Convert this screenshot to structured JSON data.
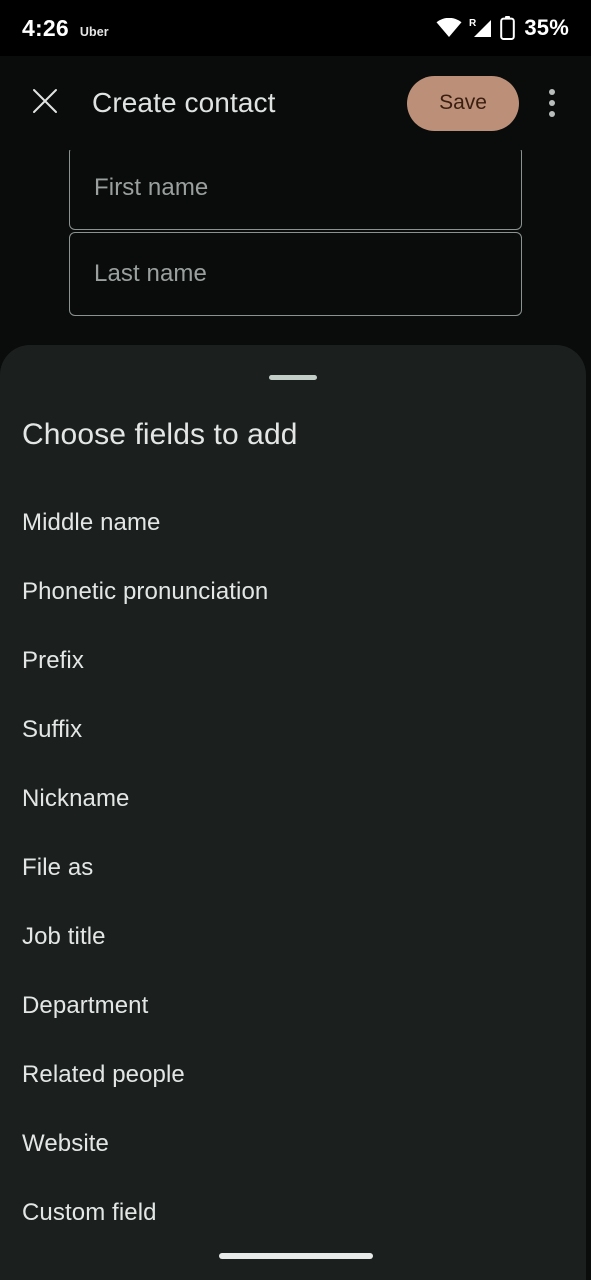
{
  "status_bar": {
    "time": "4:26",
    "notification_app": "Uber",
    "battery_percent": "35%",
    "icons": [
      "wifi-icon",
      "cellular-roaming-icon",
      "battery-icon"
    ]
  },
  "app_bar": {
    "close_icon": "close-icon",
    "title": "Create contact",
    "save_label": "Save",
    "overflow_icon": "more-vertical-icon",
    "save_bg_color": "#bc8f78",
    "save_text_color": "#3a1e10"
  },
  "form": {
    "first_name": {
      "placeholder": "First name",
      "value": ""
    },
    "last_name": {
      "placeholder": "Last name",
      "value": ""
    }
  },
  "bottom_sheet": {
    "handle": "drag-handle",
    "title": "Choose fields to add",
    "options": [
      {
        "label": "Middle name"
      },
      {
        "label": "Phonetic pronunciation"
      },
      {
        "label": "Prefix"
      },
      {
        "label": "Suffix"
      },
      {
        "label": "Nickname"
      },
      {
        "label": "File as"
      },
      {
        "label": "Job title"
      },
      {
        "label": "Department"
      },
      {
        "label": "Related people"
      },
      {
        "label": "Website"
      },
      {
        "label": "Custom field"
      }
    ],
    "background_color": "#1b201e"
  },
  "nav_bar": {
    "handle": "home-gesture-handle"
  }
}
